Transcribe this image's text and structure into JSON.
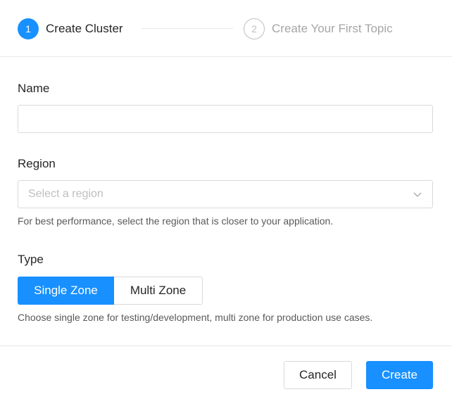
{
  "steps": [
    {
      "number": "1",
      "title": "Create Cluster",
      "status": "active"
    },
    {
      "number": "2",
      "title": "Create Your First Topic",
      "status": "pending"
    }
  ],
  "form": {
    "name": {
      "label": "Name",
      "value": "",
      "placeholder": ""
    },
    "region": {
      "label": "Region",
      "placeholder": "Select a region",
      "help": "For best performance, select the region that is closer to your application."
    },
    "type": {
      "label": "Type",
      "options": [
        "Single Zone",
        "Multi Zone"
      ],
      "selected": "Single Zone",
      "help": "Choose single zone for testing/development, multi zone for production use cases."
    }
  },
  "footer": {
    "cancel_label": "Cancel",
    "create_label": "Create"
  },
  "colors": {
    "primary": "#1890ff",
    "border": "#d9d9d9",
    "muted": "#bfbfbf"
  },
  "icons": {
    "region_select": "chevron-down-icon"
  }
}
